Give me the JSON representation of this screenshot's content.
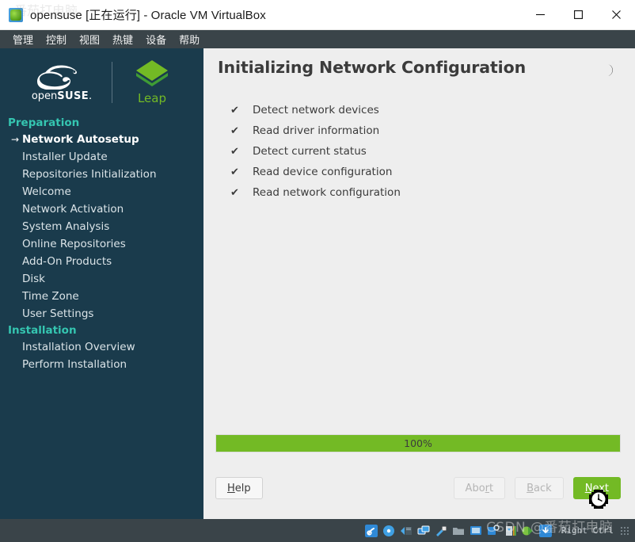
{
  "window": {
    "title": "opensuse [正在运行] - Oracle VM VirtualBox",
    "icon": "virtualbox-guest-icon",
    "minimize_label": "minimize-icon",
    "maximize_label": "maximize-icon",
    "close_label": "close-icon",
    "watermark": "番茄打电脑"
  },
  "menubar": {
    "items": [
      {
        "label": "管理"
      },
      {
        "label": "控制"
      },
      {
        "label": "视图"
      },
      {
        "label": "热键"
      },
      {
        "label": "设备"
      },
      {
        "label": "帮助"
      }
    ]
  },
  "sidebar": {
    "brand": {
      "suse_open": "open",
      "suse_bold": "SUSE",
      "suse_tm": ".",
      "product": "Leap"
    },
    "groups": [
      {
        "section": "Preparation",
        "items": [
          {
            "label": "Network Autosetup",
            "current": true
          },
          {
            "label": "Installer Update",
            "current": false
          },
          {
            "label": "Repositories Initialization",
            "current": false
          },
          {
            "label": "Welcome",
            "current": false
          },
          {
            "label": "Network Activation",
            "current": false
          },
          {
            "label": "System Analysis",
            "current": false
          },
          {
            "label": "Online Repositories",
            "current": false
          },
          {
            "label": "Add-On Products",
            "current": false
          },
          {
            "label": "Disk",
            "current": false
          },
          {
            "label": "Time Zone",
            "current": false
          },
          {
            "label": "User Settings",
            "current": false
          }
        ]
      },
      {
        "section": "Installation",
        "items": [
          {
            "label": "Installation Overview",
            "current": false
          },
          {
            "label": "Perform Installation",
            "current": false
          }
        ]
      }
    ]
  },
  "main": {
    "title": "Initializing Network Configuration",
    "dark_mode_toggle": "moon-icon",
    "check_glyph": "✔",
    "tasks": [
      {
        "label": "Detect network devices",
        "done": true
      },
      {
        "label": "Read driver information",
        "done": true
      },
      {
        "label": "Detect current status",
        "done": true
      },
      {
        "label": "Read device configuration",
        "done": true
      },
      {
        "label": "Read network configuration",
        "done": true
      }
    ],
    "progress": {
      "percent": 100,
      "text": "100%"
    },
    "buttons": {
      "help": {
        "label": "Help",
        "mnemonic": "H",
        "disabled": false
      },
      "abort": {
        "label": "Abort",
        "mnemonic": "r",
        "disabled": true
      },
      "back": {
        "label": "Back",
        "mnemonic": "B",
        "disabled": true
      },
      "next": {
        "label": "Next",
        "mnemonic": "N",
        "disabled": false
      }
    }
  },
  "statusbar": {
    "icons": [
      "hard-disk-icon",
      "optical-drive-icon",
      "floppy-drive-icon",
      "network-icon",
      "usb-icon",
      "shared-folders-icon",
      "display-icon",
      "recording-icon",
      "features-icon",
      "mouse-icon",
      "keyboard-icon"
    ],
    "host_key": "Right Ctrl",
    "watermark": "CSDN @番茄打电脑"
  },
  "colors": {
    "sidebar_bg": "#1a3b4c",
    "accent_green": "#73ba25",
    "section_teal": "#35c6b1",
    "panel_bg": "#eeeeee",
    "chrome_dark": "#3a4449"
  }
}
